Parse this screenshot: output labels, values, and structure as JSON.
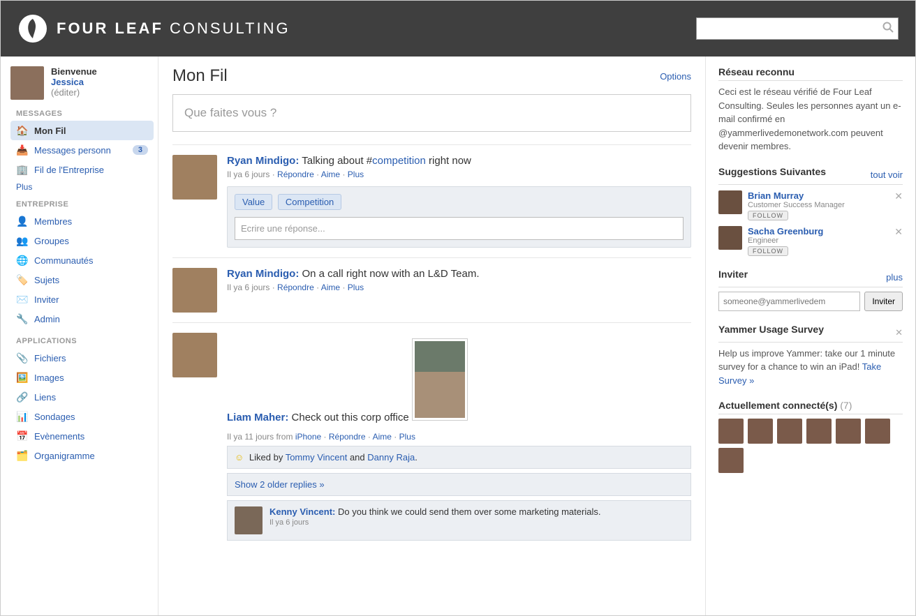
{
  "header": {
    "brand_bold": "FOUR LEAF",
    "brand_light": " CONSULTING",
    "search_placeholder": ""
  },
  "welcome": {
    "greeting": "Bienvenue",
    "name": "Jessica",
    "edit": "(éditer)"
  },
  "nav": {
    "messages_heading": "MESSAGES",
    "mon_fil": "Mon Fil",
    "messages_perso": "Messages personn",
    "messages_perso_count": "3",
    "fil_entreprise": "Fil de l'Entreprise",
    "plus": "Plus",
    "entreprise_heading": "ENTREPRISE",
    "membres": "Membres",
    "groupes": "Groupes",
    "communautes": "Communautés",
    "sujets": "Sujets",
    "inviter": "Inviter",
    "admin": "Admin",
    "applications_heading": "APPLICATIONS",
    "fichiers": "Fichiers",
    "images": "Images",
    "liens": "Liens",
    "sondages": "Sondages",
    "evenements": "Evènements",
    "organigramme": "Organigramme"
  },
  "feed": {
    "title": "Mon Fil",
    "options": "Options",
    "compose_placeholder": "Que faites vous ?",
    "reply_placeholder": "Ecrire une réponse...",
    "post1": {
      "author": "Ryan Mindigo:",
      "text_before": " Talking about #",
      "hashtag": "competition",
      "text_after": " right now",
      "time": "Il ya 6 jours",
      "tag1": "Value",
      "tag2": "Competition"
    },
    "post2": {
      "author": "Ryan Mindigo:",
      "text": " On a call right now with an L&D Team.",
      "time": "Il ya 6 jours"
    },
    "post3": {
      "author": "Liam Maher:",
      "text": " Check out this corp office",
      "time_prefix": "Il ya 11 jours from ",
      "source": "iPhone",
      "liked_prefix": " Liked by ",
      "liked1": "Tommy Vincent",
      "liked_and": " and ",
      "liked2": "Danny  Raja",
      "liked_suffix": ".",
      "older": "Show 2 older replies »",
      "reply_author": "Kenny Vincent:",
      "reply_text": " Do you think we could send them over some marketing materials.",
      "reply_time": "Il ya 6 jours"
    },
    "actions": {
      "repondre": "Répondre",
      "aime": "Aime",
      "plus": "Plus"
    }
  },
  "right": {
    "network_title": "Réseau reconnu",
    "network_desc": "Ceci est le réseau vérifié de Four Leaf Consulting. Seules les personnes ayant un e-mail confirmé en @yammerlivedemonetwork.com peuvent devenir membres.",
    "suggestions_title": "Suggestions Suivantes",
    "tout_voir": "tout voir",
    "sugg1_name": "Brian Murray",
    "sugg1_role": "Customer Success Manager",
    "sugg2_name": "Sacha Greenburg",
    "sugg2_role": "Engineer",
    "follow": "FOLLOW",
    "invite_title": "Inviter",
    "invite_plus": "plus",
    "invite_placeholder": "someone@yammerlivedem",
    "invite_btn": "Inviter",
    "survey_title": "Yammer Usage Survey",
    "survey_desc": "Help us improve Yammer: take our 1 minute survey for a chance to win an iPad! ",
    "survey_link": "Take Survey »",
    "online_title": "Actuellement connecté(s)",
    "online_count": "(7)"
  }
}
